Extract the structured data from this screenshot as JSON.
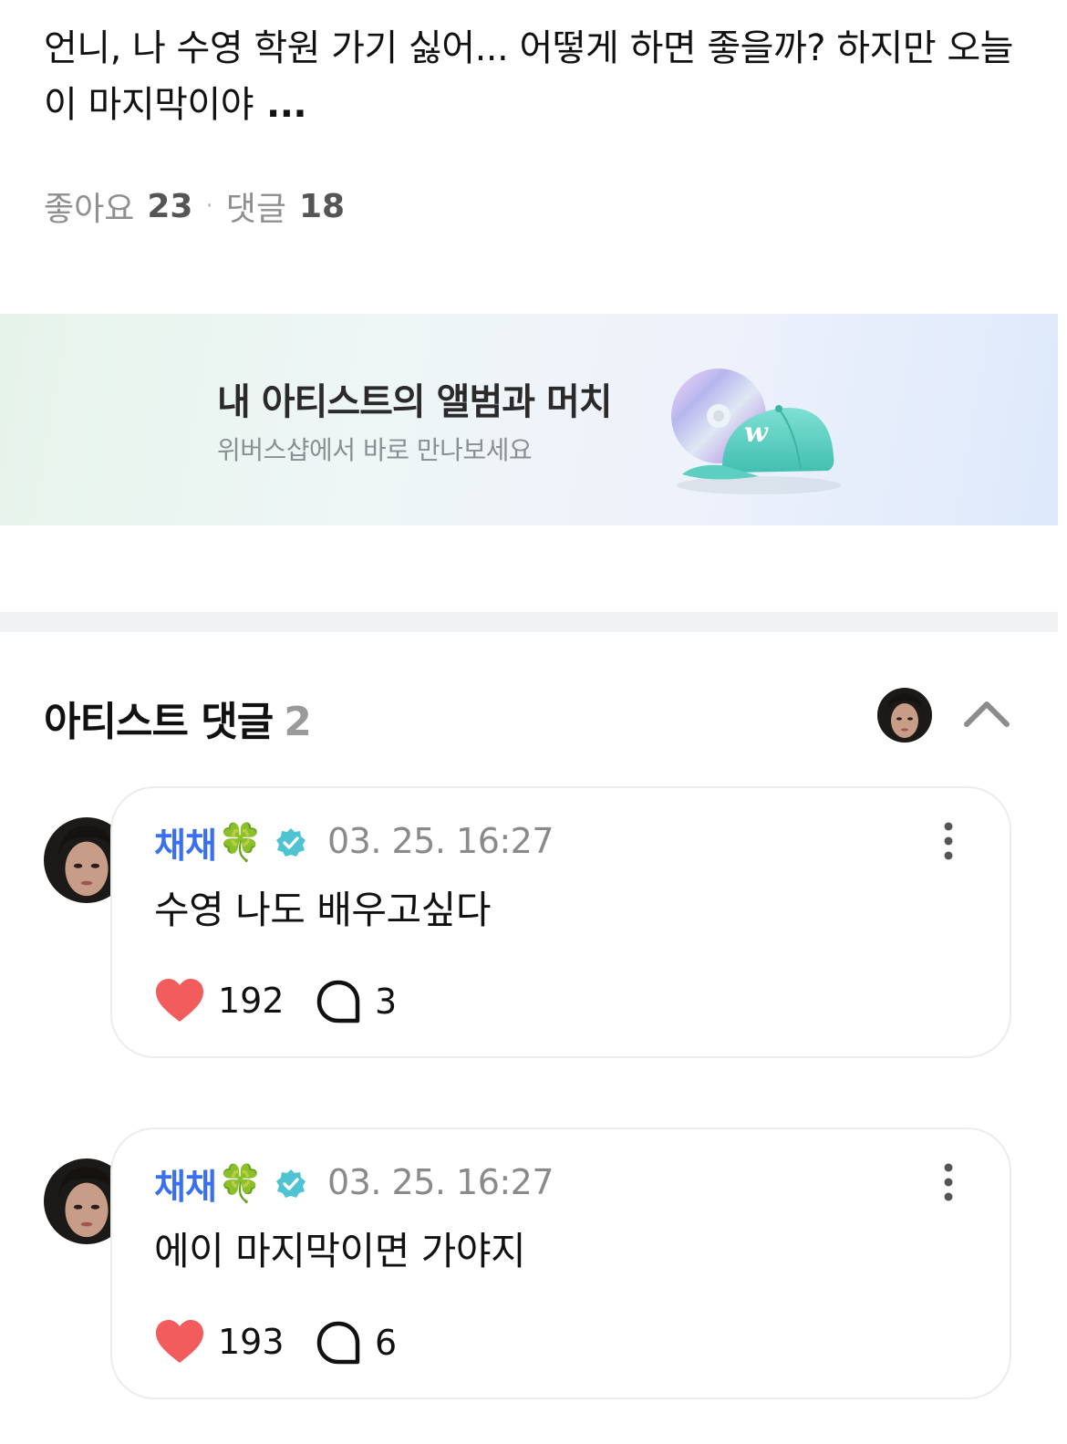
{
  "post": {
    "text": "언니, 나 수영 학원 가기 싫어... 어떻게 하면 좋을까? 하지만 오늘이 마지막이야",
    "more": "...",
    "likes_label": "좋아요",
    "likes_count": "23",
    "separator": "·",
    "comments_label": "댓글",
    "comments_count": "18"
  },
  "banner": {
    "title": "내 아티스트의 앨범과 머치",
    "subtitle": "위버스샵에서 바로 만나보세요",
    "art_icon": "cd-and-cap-icon",
    "cap_mark": "w"
  },
  "artist_comments": {
    "title": "아티스트 댓글",
    "count": "2",
    "collapse_icon": "chevron-up-icon"
  },
  "comments": [
    {
      "author": "채채",
      "badge": "🍀",
      "time": "03. 25. 16:27",
      "text": "수영 나도 배우고싶다",
      "likes": "192",
      "replies": "3"
    },
    {
      "author": "채채",
      "badge": "🍀",
      "time": "03. 25. 16:27",
      "text": "에이 마지막이면 가야지",
      "likes": "193",
      "replies": "6"
    }
  ],
  "colors": {
    "author": "#3a6ff0",
    "heart": "#f25c5c",
    "verified": "#4ec3d2",
    "muted": "#8a8a8a"
  }
}
